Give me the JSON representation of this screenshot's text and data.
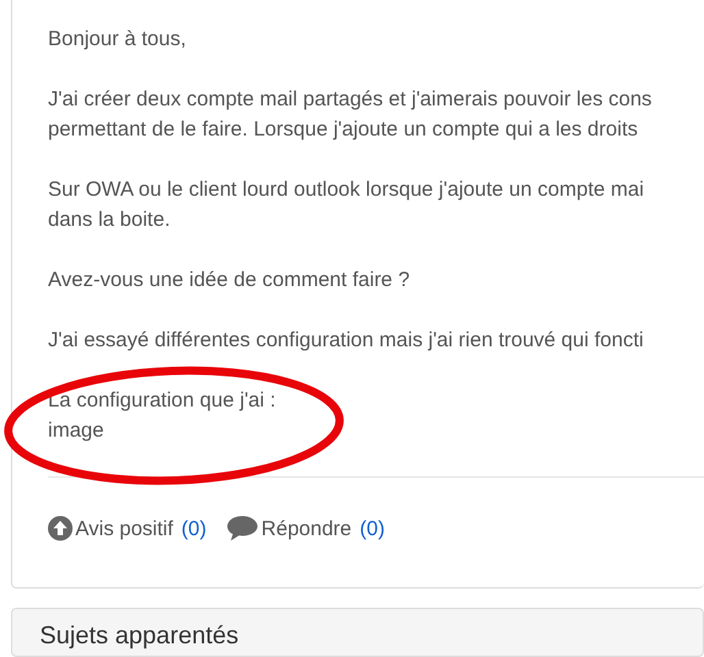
{
  "post": {
    "paragraphs": [
      [
        "Bonjour à tous,"
      ],
      [
        "J'ai créer deux compte mail partagés et j'aimerais pouvoir les cons",
        "permettant de le faire. Lorsque j'ajoute un compte qui a les droits"
      ],
      [
        "Sur OWA ou le client lourd outlook lorsque j'ajoute un compte mai",
        "dans la boite."
      ],
      [
        "Avez-vous une idée de comment faire ?"
      ],
      [
        "J'ai essayé différentes configuration mais j'ai rien trouvé qui foncti"
      ],
      [
        "La configuration que j'ai :",
        "image"
      ]
    ],
    "annotations": [
      {
        "kind": "ellipse"
      }
    ],
    "actions": [
      {
        "kind": "upvote",
        "label": "Avis positif",
        "count": "(0)"
      },
      {
        "kind": "reply",
        "label": "Répondre",
        "count": "(0)"
      }
    ]
  },
  "related": {
    "title": "Sujets apparentés"
  }
}
